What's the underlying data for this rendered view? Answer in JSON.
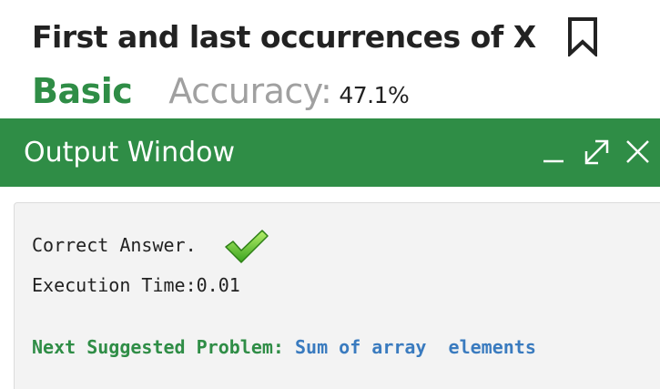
{
  "problem": {
    "title": "First and last occurrences of X",
    "difficulty": "Basic",
    "accuracy_label": "Accuracy:",
    "accuracy_value": "47.1%",
    "bookmark_icon": "bookmark-icon"
  },
  "output_window": {
    "title": "Output Window",
    "controls": {
      "minimize_icon": "minimize-icon",
      "expand_icon": "expand-icon",
      "close_icon": "close-icon"
    },
    "result_text": "Correct Answer.",
    "result_icon": "checkmark-icon",
    "execution_time": "Execution Time:0.01",
    "next_label": "Next Suggested Problem: ",
    "next_link": "Sum of array  elements"
  },
  "colors": {
    "accent_green": "#2f8d46",
    "link_blue": "#3a7bbf",
    "muted_gray": "#a0a0a0",
    "body_bg": "#f3f3f3"
  }
}
